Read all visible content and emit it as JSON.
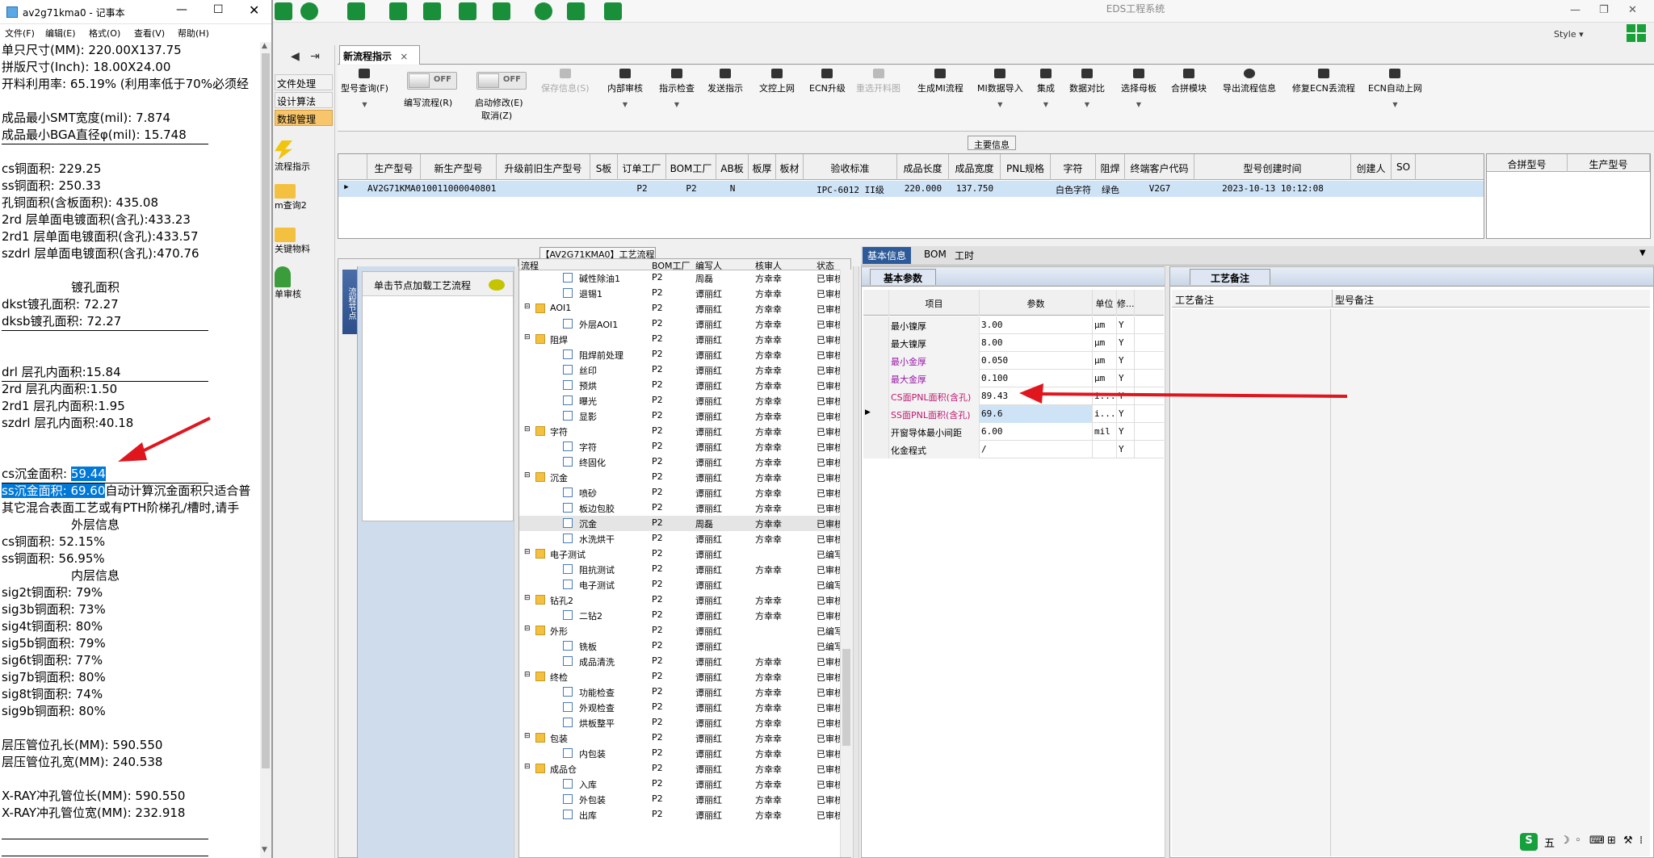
{
  "eds": {
    "title": "EDS工程系统",
    "style_label": "Style ▾",
    "nav_items": [
      "文件处理",
      "设计算法",
      "数据管理"
    ],
    "nav_icons": [
      "流程指示",
      "m查询2",
      "关键物料",
      "单审核"
    ],
    "tab_label": "新流程指示",
    "toolbar": [
      "型号查询(F)",
      "编写流程(R)",
      "启动修改(E)",
      "取消(Z)",
      "保存信息(S)",
      "内部审核",
      "指示检查",
      "发送指示",
      "文控上网",
      "ECN升级",
      "重选开料图",
      "生成MI流程",
      "MI数据导入",
      "集成",
      "数据对比",
      "选择母板",
      "合拼模块",
      "导出流程信息",
      "修复ECN丢流程",
      "ECN自动上网"
    ],
    "toggle_off": "OFF",
    "main_info": "主要信息",
    "grid_headers": [
      "生产型号",
      "新生产型号",
      "升级前旧生产型号",
      "S板",
      "订单工厂",
      "BOM工厂",
      "AB板",
      "板厚",
      "板材",
      "验收标准",
      "成品长度",
      "成品宽度",
      "PNL规格",
      "字符",
      "阻焊",
      "终端客户代码",
      "型号创建时间",
      "创建人",
      "SO"
    ],
    "grid_row": {
      "c1": "AV2G71KMA0",
      "c2": "10011000040801",
      "c4": "P2",
      "c5": "P2",
      "c6": "N",
      "c9": "IPC-6012 II级",
      "c10": "220.000",
      "c11": "137.750",
      "c13": "白色字符",
      "c14": "绿色",
      "c15": "V2G7",
      "c16": "2023-10-13 10:12:08"
    },
    "right_headers": [
      "合拼型号",
      "生产型号"
    ],
    "process_title": "【AV2G71KMA0】工艺流程",
    "vert_tab": "流程节点",
    "hint": "单击节点加载工艺流程",
    "tree_headers": [
      "流程",
      "BOM工厂",
      "编写人",
      "核审人",
      "状态"
    ],
    "tree_rows": [
      [
        "碱性除油1",
        "P2",
        "周磊",
        "方幸幸",
        "已审核"
      ],
      [
        "退锡1",
        "P2",
        "谭丽红",
        "方幸幸",
        "已审核"
      ],
      [
        "AOI1",
        "P2",
        "谭丽红",
        "方幸幸",
        "已审核"
      ],
      [
        "外层AOI1",
        "P2",
        "谭丽红",
        "方幸幸",
        "已审核"
      ],
      [
        "阻焊",
        "P2",
        "谭丽红",
        "方幸幸",
        "已审核"
      ],
      [
        "阻焊前处理",
        "P2",
        "谭丽红",
        "方幸幸",
        "已审核"
      ],
      [
        "丝印",
        "P2",
        "谭丽红",
        "方幸幸",
        "已审核"
      ],
      [
        "预烘",
        "P2",
        "谭丽红",
        "方幸幸",
        "已审核"
      ],
      [
        "曝光",
        "P2",
        "谭丽红",
        "方幸幸",
        "已审核"
      ],
      [
        "显影",
        "P2",
        "谭丽红",
        "方幸幸",
        "已审核"
      ],
      [
        "字符",
        "P2",
        "谭丽红",
        "方幸幸",
        "已审核"
      ],
      [
        "字符",
        "P2",
        "谭丽红",
        "方幸幸",
        "已审核"
      ],
      [
        "终固化",
        "P2",
        "谭丽红",
        "方幸幸",
        "已审核"
      ],
      [
        "沉金",
        "P2",
        "谭丽红",
        "方幸幸",
        "已审核"
      ],
      [
        "喷砂",
        "P2",
        "谭丽红",
        "方幸幸",
        "已审核"
      ],
      [
        "板边包胶",
        "P2",
        "谭丽红",
        "方幸幸",
        "已审核"
      ],
      [
        "沉金",
        "P2",
        "周磊",
        "方幸幸",
        "已审核"
      ],
      [
        "水洗烘干",
        "P2",
        "谭丽红",
        "方幸幸",
        "已审核"
      ],
      [
        "电子测试",
        "P2",
        "谭丽红",
        "",
        "已编写"
      ],
      [
        "阻抗测试",
        "P2",
        "谭丽红",
        "方幸幸",
        "已审核"
      ],
      [
        "电子测试",
        "P2",
        "谭丽红",
        "",
        "已编写"
      ],
      [
        "钻孔2",
        "P2",
        "谭丽红",
        "方幸幸",
        "已审核"
      ],
      [
        "二钻2",
        "P2",
        "谭丽红",
        "方幸幸",
        "已审核"
      ],
      [
        "外形",
        "P2",
        "谭丽红",
        "",
        "已编写"
      ],
      [
        "铣板",
        "P2",
        "谭丽红",
        "",
        "已编写"
      ],
      [
        "成品清洗",
        "P2",
        "谭丽红",
        "方幸幸",
        "已审核"
      ],
      [
        "终检",
        "P2",
        "谭丽红",
        "方幸幸",
        "已审核"
      ],
      [
        "功能检查",
        "P2",
        "谭丽红",
        "方幸幸",
        "已审核"
      ],
      [
        "外观检查",
        "P2",
        "谭丽红",
        "方幸幸",
        "已审核"
      ],
      [
        "烘板整平",
        "P2",
        "谭丽红",
        "方幸幸",
        "已审核"
      ],
      [
        "包装",
        "P2",
        "谭丽红",
        "方幸幸",
        "已审核"
      ],
      [
        "内包装",
        "P2",
        "谭丽红",
        "方幸幸",
        "已审核"
      ],
      [
        "成品仓",
        "P2",
        "谭丽红",
        "方幸幸",
        "已审核"
      ],
      [
        "入库",
        "P2",
        "谭丽红",
        "方幸幸",
        "已审核"
      ],
      [
        "外包装",
        "P2",
        "谭丽红",
        "方幸幸",
        "已审核"
      ],
      [
        "出库",
        "P2",
        "谭丽红",
        "方幸幸",
        "已审核"
      ]
    ],
    "detail_tabs": [
      "基本信息",
      "BOM",
      "工时"
    ],
    "basic_params_tab": "基本参数",
    "param_headers": [
      "项目",
      "参数",
      "单位",
      "修..."
    ],
    "params": [
      [
        "最小镍厚",
        "3.00",
        "μm",
        "Y"
      ],
      [
        "最大镍厚",
        "8.00",
        "μm",
        "Y"
      ],
      [
        "最小金厚",
        "0.050",
        "μm",
        "Y"
      ],
      [
        "最大金厚",
        "0.100",
        "μm",
        "Y"
      ],
      [
        "CS面PNL面积(含孔)",
        "89.43",
        "i...",
        "Y"
      ],
      [
        "SS面PNL面积(含孔)",
        "69.6",
        "i...",
        "Y"
      ],
      [
        "开窗导体最小间距",
        "6.00",
        "mil",
        "Y"
      ],
      [
        "化金程式",
        "/",
        "",
        "Y"
      ]
    ],
    "remark_tab": "工艺备注",
    "remark_headers": [
      "工艺备注",
      "型号备注"
    ],
    "tray": [
      "S",
      "五",
      "☽",
      "◦",
      "⌨",
      "⊞",
      "⚒",
      "⁞"
    ],
    "colors": {
      "accent": "#2d5b9a",
      "selected_row": "#cfe3f7",
      "nav_selected": "#f7c56b",
      "arrow": "#e0161e"
    }
  },
  "notepad": {
    "title": "av2g71kma0 - 记事本",
    "menu": [
      "文件(F)",
      "编辑(E)",
      "格式(O)",
      "查看(V)",
      "帮助(H)"
    ],
    "lines": [
      "单只尺寸(MM): 220.00X137.75",
      "拼版尺寸(Inch): 18.00X24.00",
      "开料利用率: 65.19% (利用率低于70%必须经",
      "",
      "成品最小SMT宽度(mil): 7.874",
      "成品最小BGA直径φ(mil):  15.748",
      "",
      "cs铜面积: 229.25",
      "ss铜面积: 250.33",
      "孔铜面积(含板面积): 435.08",
      "2rd         层单面电镀面积(含孔):433.23",
      "2rd1        层单面电镀面积(含孔):433.57",
      "szdrl       层单面电镀面积(含孔):470.76",
      "",
      "镀孔面积",
      "dkst镀孔面积: 72.27",
      "dksb镀孔面积: 72.27",
      "",
      "",
      "drl          层孔内面积:15.84",
      "2rd          层孔内面积:1.50",
      "2rd1          层孔内面积:1.95",
      "szdrl        层孔内面积:40.18",
      "",
      "",
      "cs沉金面积: ",
      "ss沉金面积: 69.60",
      "其它混合表面工艺或有PTH阶梯孔/槽时,请手",
      "外层信息",
      "cs铜面积: 52.15%",
      "ss铜面积: 56.95%",
      "内层信息",
      "sig2t铜面积: 79%",
      "sig3b铜面积: 73%",
      "sig4t铜面积: 80%",
      "sig5b铜面积: 79%",
      "sig6t铜面积: 77%",
      "sig7b铜面积: 80%",
      "sig8t铜面积: 74%",
      "sig9b铜面积: 80%",
      "",
      "层压管位孔长(MM): 590.550",
      "层压管位孔宽(MM): 240.538",
      "",
      "X-RAY冲孔管位长(MM): 590.550",
      "X-RAY冲孔管位宽(MM): 232.918"
    ],
    "cs_gold_value": "59.44",
    "ss_gold_suffix": "自动计算沉金面积只适合普"
  }
}
